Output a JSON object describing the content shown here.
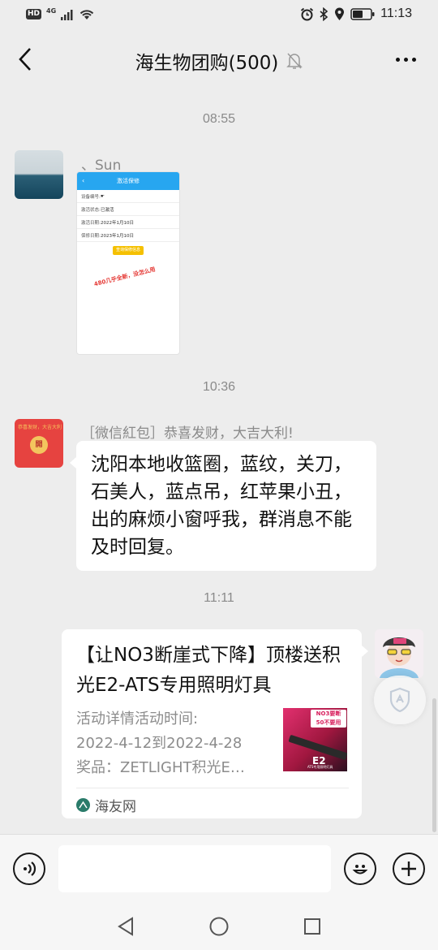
{
  "status_bar": {
    "network_badge": "HD",
    "network_type": "4G",
    "time": "11:13"
  },
  "nav": {
    "title": "海生物团购(500)"
  },
  "messages": {
    "time_1": "08:55",
    "sender_1": "、Sun",
    "screenshot": {
      "header": "激活保修",
      "rows": [
        {
          "key": "设备编号:",
          "value": "☛"
        },
        {
          "key": "激活状态:",
          "value": "已激活"
        },
        {
          "key": "激活日期:",
          "value": "2022年1月10日"
        },
        {
          "key": "保修日期:",
          "value": "2023年1月10日"
        }
      ],
      "button": "查询保修信息",
      "note": "480几乎全新，没怎么用"
    },
    "time_2": "10:36",
    "sender_2": "［微信紅包］恭喜发财，大吉大利!",
    "hongbao_avatar_text": "恭喜发财，大吉大利",
    "hongbao_coin": "開",
    "text_bubble": "沈阳本地收篮圈，蓝纹，关刀，石美人，蓝点吊，红苹果小丑，出的麻烦小窗呼我，群消息不能及时回复。",
    "time_3": "11:11",
    "link_card": {
      "title": "【让NO3断崖式下降】顶楼送积光E2-ATS专用照明灯具",
      "desc_line1": "活动详情活动时间:",
      "desc_line2": "2022-4-12到2022-4-28",
      "desc_line3": "奖品：ZETLIGHT积光E…",
      "thumb_text1": "NO3要断",
      "thumb_text2": "50不要用",
      "thumb_brand": "E2",
      "thumb_small": "ATS专用照明灯具",
      "source": "海友网"
    }
  },
  "icons": {
    "back": "chevron-left-icon",
    "mute": "bell-off-icon",
    "more": "more-dots-icon",
    "voice": "voice-icon",
    "emoji": "emoji-icon",
    "plus": "plus-icon"
  },
  "colors": {
    "background": "#ededed",
    "bubble": "#ffffff",
    "hongbao": "#e64340",
    "screenshot_header": "#27a6f0"
  }
}
